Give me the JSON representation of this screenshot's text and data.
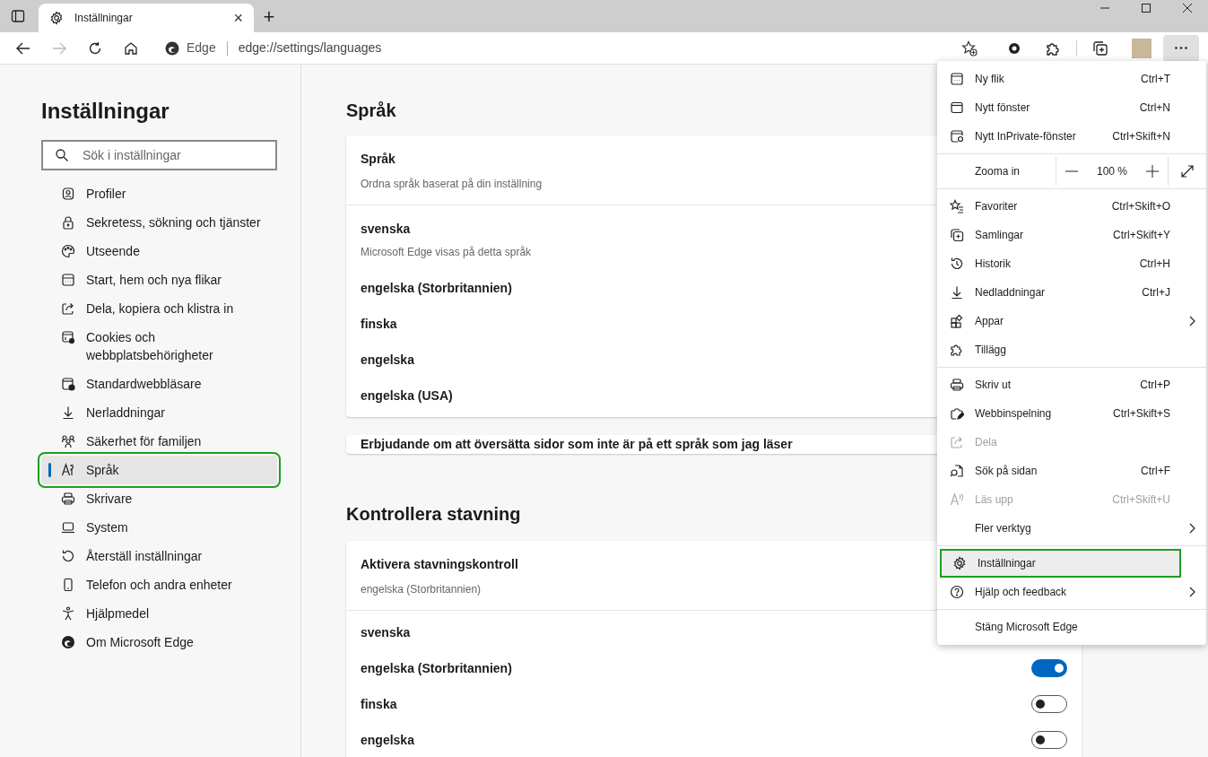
{
  "tab": {
    "title": "Inställningar",
    "close": "×"
  },
  "new_tab": "+",
  "address_bar": {
    "site": "Edge",
    "url": "edge://settings/languages"
  },
  "sidebar": {
    "title": "Inställningar",
    "search": {
      "placeholder": "Sök i inställningar"
    },
    "items": [
      {
        "label": "Profiler",
        "selected": false,
        "highlighted": false
      },
      {
        "label": "Sekretess, sökning och tjänster",
        "selected": false,
        "highlighted": false
      },
      {
        "label": "Utseende",
        "selected": false,
        "highlighted": false
      },
      {
        "label": "Start, hem och nya flikar",
        "selected": false,
        "highlighted": false
      },
      {
        "label": "Dela, kopiera och klistra in",
        "selected": false,
        "highlighted": false
      },
      {
        "label": "Cookies och webbplatsbehörigheter",
        "selected": false,
        "highlighted": false
      },
      {
        "label": "Standardwebbläsare",
        "selected": false,
        "highlighted": false
      },
      {
        "label": "Nerladdningar",
        "selected": false,
        "highlighted": false
      },
      {
        "label": "Säkerhet för familjen",
        "selected": false,
        "highlighted": false
      },
      {
        "label": "Språk",
        "selected": true,
        "highlighted": true
      },
      {
        "label": "Skrivare",
        "selected": false,
        "highlighted": false
      },
      {
        "label": "System",
        "selected": false,
        "highlighted": false
      },
      {
        "label": "Återställ inställningar",
        "selected": false,
        "highlighted": false
      },
      {
        "label": "Telefon och andra enheter",
        "selected": false,
        "highlighted": false
      },
      {
        "label": "Hjälpmedel",
        "selected": false,
        "highlighted": false
      },
      {
        "label": "Om Microsoft Edge",
        "selected": false,
        "highlighted": false
      }
    ]
  },
  "languages": {
    "heading": "Språk",
    "card_title": "Språk",
    "card_subtitle": "Ordna språk baserat på din inställning",
    "items": [
      {
        "name": "svenska",
        "note": "Microsoft Edge visas på detta språk"
      },
      {
        "name": "engelska (Storbritannien)"
      },
      {
        "name": "finska"
      },
      {
        "name": "engelska"
      },
      {
        "name": "engelska (USA)"
      }
    ],
    "offer": "Erbjudande om att översätta sidor som inte är på ett språk som jag läser"
  },
  "spelling": {
    "heading": "Kontrollera stavning",
    "card_title": "Aktivera stavningskontroll",
    "card_subtitle": "engelska (Storbritannien)",
    "items": [
      {
        "name": "svenska"
      },
      {
        "name": "engelska (Storbritannien)",
        "on": true
      },
      {
        "name": "finska",
        "on": false
      },
      {
        "name": "engelska",
        "on": false
      }
    ]
  },
  "menu": {
    "items": [
      {
        "kind": "item",
        "label": "Ny flik",
        "shortcut": "Ctrl+T",
        "disabled": false,
        "highlighted": false
      },
      {
        "kind": "item",
        "label": "Nytt fönster",
        "shortcut": "Ctrl+N",
        "disabled": false,
        "highlighted": false
      },
      {
        "kind": "item",
        "label": "Nytt InPrivate-fönster",
        "shortcut": "Ctrl+Skift+N",
        "disabled": false,
        "highlighted": false
      },
      {
        "kind": "separator"
      },
      {
        "kind": "zoom",
        "label": "Zooma in",
        "value": "100 %"
      },
      {
        "kind": "separator"
      },
      {
        "kind": "item",
        "label": "Favoriter",
        "shortcut": "Ctrl+Skift+O",
        "disabled": false,
        "highlighted": false
      },
      {
        "kind": "item",
        "label": "Samlingar",
        "shortcut": "Ctrl+Skift+Y",
        "disabled": false,
        "highlighted": false
      },
      {
        "kind": "item",
        "label": "Historik",
        "shortcut": "Ctrl+H",
        "disabled": false,
        "highlighted": false
      },
      {
        "kind": "item",
        "label": "Nedladdningar",
        "shortcut": "Ctrl+J",
        "disabled": false,
        "highlighted": false
      },
      {
        "kind": "item",
        "label": "Appar",
        "submenu": true,
        "disabled": false,
        "highlighted": false
      },
      {
        "kind": "item",
        "label": "Tillägg",
        "disabled": false,
        "highlighted": false
      },
      {
        "kind": "separator"
      },
      {
        "kind": "item",
        "label": "Skriv ut",
        "shortcut": "Ctrl+P",
        "disabled": false,
        "highlighted": false
      },
      {
        "kind": "item",
        "label": "Webbinspelning",
        "shortcut": "Ctrl+Skift+S",
        "disabled": false,
        "highlighted": false
      },
      {
        "kind": "item",
        "label": "Dela",
        "disabled": true,
        "highlighted": false
      },
      {
        "kind": "item",
        "label": "Sök på sidan",
        "shortcut": "Ctrl+F",
        "disabled": false,
        "highlighted": false
      },
      {
        "kind": "item",
        "label": "Läs upp",
        "shortcut": "Ctrl+Skift+U",
        "disabled": true,
        "highlighted": false
      },
      {
        "kind": "item",
        "label": "Fler verktyg",
        "submenu": true,
        "disabled": false,
        "highlighted": false
      },
      {
        "kind": "separator"
      },
      {
        "kind": "item",
        "label": "Inställningar",
        "disabled": false,
        "highlighted": true
      },
      {
        "kind": "item",
        "label": "Hjälp och feedback",
        "submenu": true,
        "disabled": false,
        "highlighted": false
      },
      {
        "kind": "separator"
      },
      {
        "kind": "item",
        "label": "Stäng Microsoft Edge",
        "disabled": false,
        "highlighted": false
      }
    ]
  }
}
